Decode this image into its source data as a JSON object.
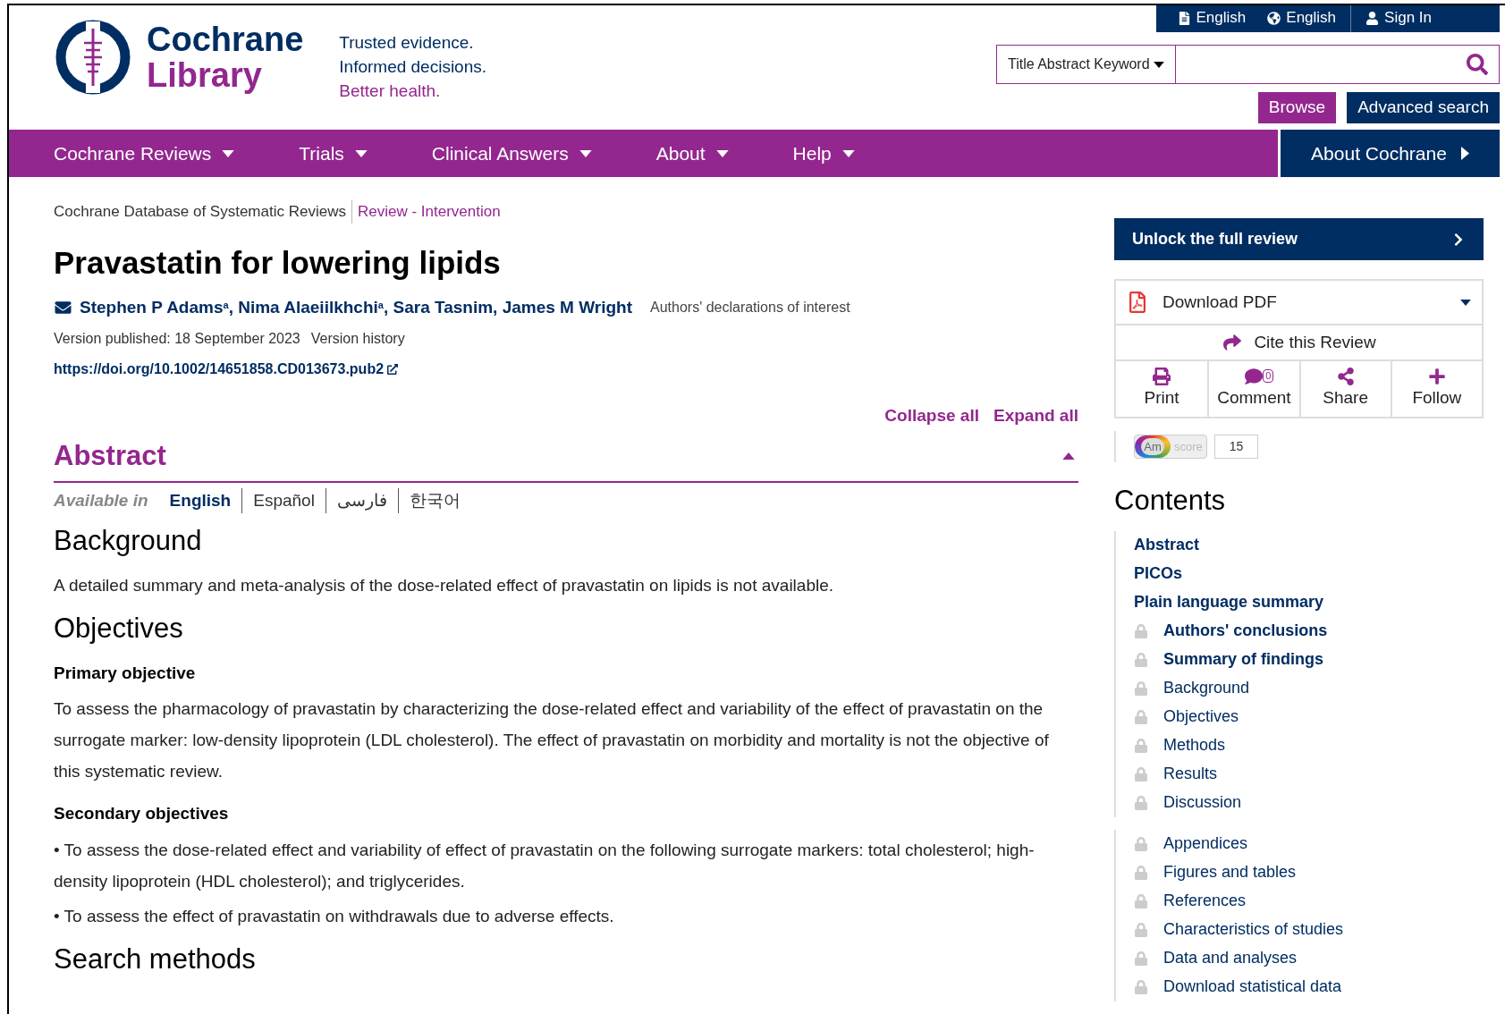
{
  "top_bar": {
    "items": [
      {
        "kind": "document",
        "label": "English"
      },
      {
        "kind": "globe",
        "label": "English"
      },
      {
        "kind": "user",
        "label": "Sign In"
      }
    ]
  },
  "logo": {
    "line1": "Cochrane",
    "line2": "Library"
  },
  "tagline": [
    "Trusted evidence.",
    "Informed decisions.",
    "Better health."
  ],
  "search": {
    "scope": "Title Abstract Keyword",
    "buttons": [
      {
        "kind": "browse",
        "label": "Browse"
      },
      {
        "kind": "advanced",
        "label": "Advanced search"
      }
    ]
  },
  "nav": {
    "items": [
      "Cochrane Reviews",
      "Trials",
      "Clinical Answers",
      "About",
      "Help"
    ],
    "about_link": "About Cochrane"
  },
  "breadcrumb": [
    "Cochrane Database of Systematic Reviews",
    "Review - Intervention"
  ],
  "title": "Pravastatin for lowering lipids",
  "authors": "Stephen P Adams$^{a}$, Nima Alaeiilkhchi$^{a}$, Sara Tasnim, James M Wright",
  "declarations_link": "Authors' declarations of interest",
  "version_published": "Version published: 18 September 2023",
  "version_history": "Version history",
  "doi": "https://doi.org/10.1002/14651858.CD013673.pub2",
  "collapse_all": "Collapse all",
  "expand_all": "Expand all",
  "abstract": {
    "heading": "Abstract",
    "expanded": true,
    "available_in": "Available in",
    "languages": [
      {
        "label": "English",
        "selected": true
      },
      {
        "label": "Español",
        "selected": false
      },
      {
        "label": "فارسی",
        "selected": false
      },
      {
        "label": "한국어",
        "selected": false
      }
    ],
    "sections": [
      {
        "kind": "h2",
        "text": "Background"
      },
      {
        "kind": "p",
        "text": "A detailed summary and meta-analysis of the dose-related effect of pravastatin on lipids is not available."
      },
      {
        "kind": "h2",
        "text": "Objectives"
      },
      {
        "kind": "h3",
        "text": "Primary objective"
      },
      {
        "kind": "p",
        "text": "To assess the pharmacology of pravastatin by characterizing the dose-related effect and variability of the effect of pravastatin on the surrogate marker: low-density lipoprotein (LDL cholesterol). The effect of pravastatin on morbidity and mortality is not the objective of this systematic review."
      },
      {
        "kind": "h3",
        "text": "Secondary objectives"
      },
      {
        "kind": "p",
        "text": "• To assess the dose-related effect and variability of effect of pravastatin on the following surrogate markers: total cholesterol; high-density lipoprotein (HDL cholesterol); and triglycerides."
      },
      {
        "kind": "p",
        "text": "• To assess the effect of pravastatin on withdrawals due to adverse effects."
      },
      {
        "kind": "h2",
        "text": "Search methods"
      }
    ]
  },
  "sidebar": {
    "unlock": "Unlock the full review",
    "download_pdf": "Download PDF",
    "cite": "Cite this Review",
    "actions": [
      {
        "kind": "print",
        "label": "Print"
      },
      {
        "kind": "comment",
        "label": "Comment",
        "count": "0"
      },
      {
        "kind": "share",
        "label": "Share"
      },
      {
        "kind": "follow",
        "label": "Follow"
      }
    ],
    "altmetric": {
      "badge": "Am",
      "label": "score",
      "value": "15"
    },
    "contents_heading": "Contents",
    "contents_groups": [
      [
        {
          "label": "Abstract",
          "locked": false,
          "bold": true
        },
        {
          "label": "PICOs",
          "locked": false,
          "bold": true
        },
        {
          "label": "Plain language summary",
          "locked": false,
          "bold": true
        },
        {
          "label": "Authors' conclusions",
          "locked": true,
          "bold": true
        },
        {
          "label": "Summary of findings",
          "locked": true,
          "bold": true
        },
        {
          "label": "Background",
          "locked": true,
          "bold": false
        },
        {
          "label": "Objectives",
          "locked": true,
          "bold": false
        },
        {
          "label": "Methods",
          "locked": true,
          "bold": false
        },
        {
          "label": "Results",
          "locked": true,
          "bold": false
        },
        {
          "label": "Discussion",
          "locked": true,
          "bold": false
        }
      ],
      [
        {
          "label": "Appendices",
          "locked": true,
          "bold": false
        },
        {
          "label": "Figures and tables",
          "locked": true,
          "bold": false
        },
        {
          "label": "References",
          "locked": true,
          "bold": false
        },
        {
          "label": "Characteristics of studies",
          "locked": true,
          "bold": false
        },
        {
          "label": "Data and analyses",
          "locked": true,
          "bold": false
        },
        {
          "label": "Download statistical data",
          "locked": true,
          "bold": false
        }
      ]
    ]
  }
}
